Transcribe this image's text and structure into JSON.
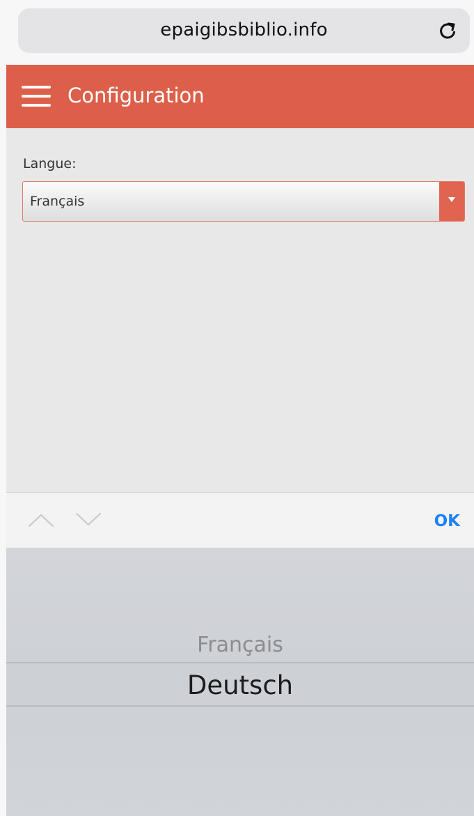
{
  "browser": {
    "url": "epaigibsbiblio.info",
    "reload_icon": "reload-icon"
  },
  "header": {
    "menu_icon": "hamburger-menu-icon",
    "title": "Configuration",
    "color": "#dd5f4a"
  },
  "settings": {
    "language_label": "Langue:",
    "language_value": "Français",
    "dropdown_icon": "chevron-down-icon"
  },
  "picker_toolbar": {
    "prev_icon": "chevron-up-icon",
    "next_icon": "chevron-down-icon",
    "ok_label": "OK",
    "ok_color": "#1a82f7"
  },
  "picker": {
    "options": [
      "Français",
      "Deutsch"
    ],
    "selected": "Deutsch"
  }
}
